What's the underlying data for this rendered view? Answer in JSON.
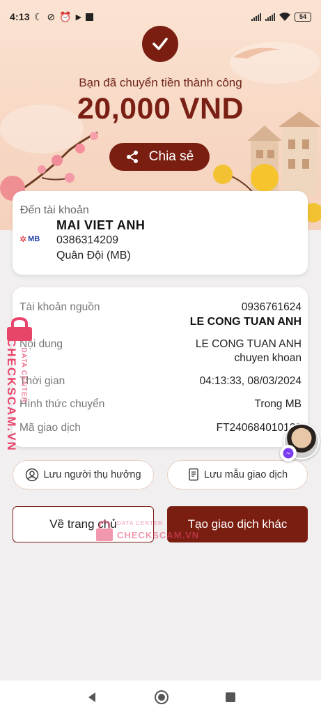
{
  "status": {
    "time": "4:13",
    "battery": "54"
  },
  "hero": {
    "success_text": "Bạn đã chuyển tiền thành công",
    "amount": "20,000 VND",
    "share_label": "Chia sẻ"
  },
  "destination": {
    "title": "Đến tài khoản",
    "bank_logo": "MB",
    "name": "MAI VIET ANH",
    "account": "0386314209",
    "bank": "Quân Đội (MB)"
  },
  "details": {
    "source_label": "Tài khoản nguồn",
    "source_account": "0936761624",
    "source_name": "LE CONG TUAN ANH",
    "content_label": "Nội dung",
    "content_line1": "LE CONG TUAN ANH",
    "content_line2": "chuyen khoan",
    "time_label": "Thời gian",
    "time_value": "04:13:33, 08/03/2024",
    "method_label": "Hình thức chuyển",
    "method_value": "Trong MB",
    "txn_label": "Mã giao dịch",
    "txn_value": "FT240684010128"
  },
  "actions": {
    "save_beneficiary": "Lưu người thụ hưởng",
    "save_template": "Lưu mẫu giao dịch",
    "home": "Về trang chủ",
    "new_transaction": "Tạo giao dịch khác"
  },
  "watermark": {
    "brand": "CHECKSCAM.VN",
    "sub": "DATA CENTER"
  },
  "colors": {
    "primary": "#7b1e12",
    "hero_bg": "#f7d8c4",
    "page_bg": "#f1efef"
  }
}
